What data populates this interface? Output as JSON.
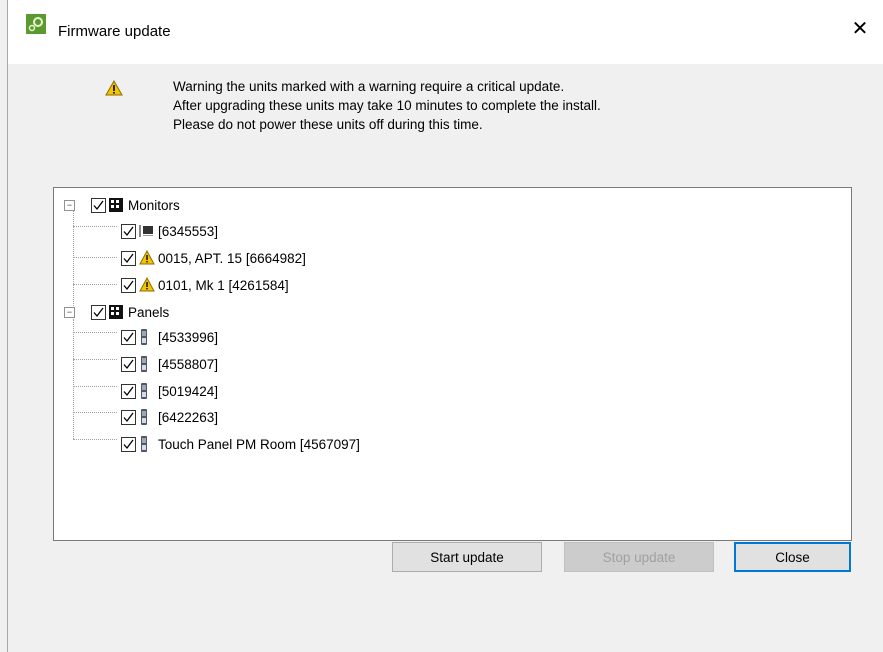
{
  "window": {
    "title": "Firmware update",
    "close_glyph": "✕"
  },
  "warning": {
    "line1": "Warning the units marked with a warning require a critical update.",
    "line2": "After upgrading these units may take 10 minutes to complete the install.",
    "line3": "Please do not power these units off during this time."
  },
  "tree": {
    "groups": [
      {
        "label": "Monitors",
        "items": [
          {
            "label": "[6345553]",
            "icon": "monitor-icon"
          },
          {
            "label": "0015, APT. 15 [6664982]",
            "icon": "warning-icon"
          },
          {
            "label": "0101, Mk 1 [4261584]",
            "icon": "warning-icon"
          }
        ]
      },
      {
        "label": "Panels",
        "items": [
          {
            "label": "[4533996]",
            "icon": "panel-icon"
          },
          {
            "label": "[4558807]",
            "icon": "panel-icon"
          },
          {
            "label": "[5019424]",
            "icon": "panel-icon"
          },
          {
            "label": "[6422263]",
            "icon": "panel-icon"
          },
          {
            "label": "Touch Panel PM Room [4567097]",
            "icon": "panel-icon"
          }
        ]
      }
    ]
  },
  "buttons": {
    "start": "Start update",
    "stop": "Stop update",
    "close": "Close"
  }
}
